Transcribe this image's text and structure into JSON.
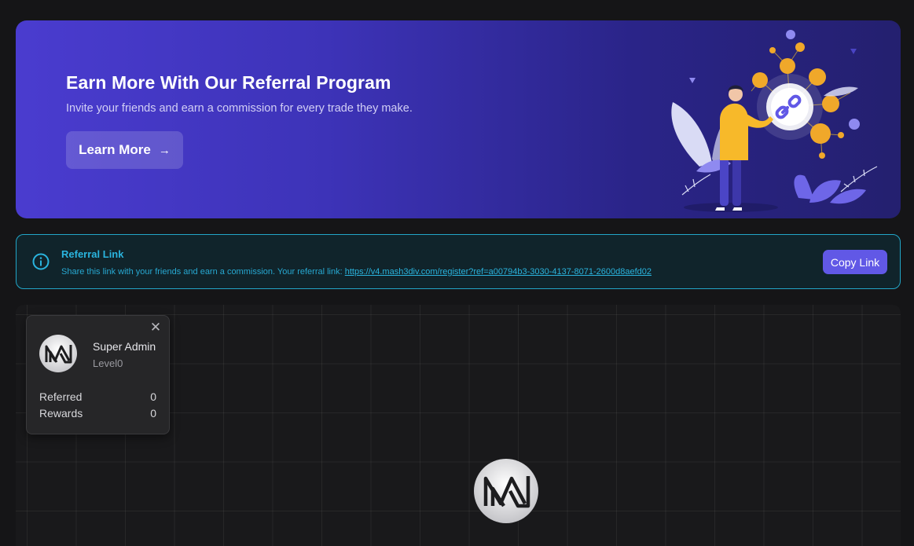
{
  "banner": {
    "title": "Earn More With Our Referral Program",
    "subtitle": "Invite your friends and earn a commission for every trade they make.",
    "button_label": "Learn More",
    "button_icon": "arrow-right-icon"
  },
  "referral": {
    "title": "Referral Link",
    "description": "Share this link with your friends and earn a commission. Your referral link:",
    "link": "https://v4.mash3div.com/register?ref=a00794b3-3030-4137-8071-2600d8aefd02",
    "copy_label": "Copy Link",
    "icon": "info-icon"
  },
  "tree": {
    "card": {
      "name": "Super Admin",
      "level": "Level0",
      "stats": [
        {
          "label": "Referred",
          "value": "0"
        },
        {
          "label": "Rewards",
          "value": "0"
        }
      ],
      "close_icon": "close-icon"
    }
  },
  "colors": {
    "banner_start": "#4a3ccf",
    "banner_end": "#24206f",
    "accent": "#6158e6",
    "info": "#2ab4de",
    "background": "#151517"
  }
}
